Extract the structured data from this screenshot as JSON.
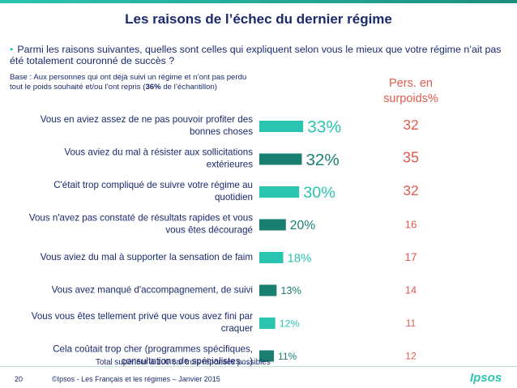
{
  "title": "Les raisons de l’échec du dernier régime",
  "question": "Parmi les raisons suivantes, quelles sont celles qui expliquent selon vous le mieux que votre régime n’ait pas été totalement couronné de succès ?",
  "base": {
    "text_before": "Base : Aux personnes qui ont déjà suivi un régime et n’ont pas perdu tout le poids souhaité et/ou l’ont repris (",
    "bold": "36%",
    "text_after": " de l’échantillon)"
  },
  "column_header": {
    "line1": "Pers. en",
    "line2": "surpoids%"
  },
  "footnote": "Total supérieur à 100 car trois réponses possibles",
  "footer": {
    "page_number": "20",
    "source": "©Ipsos - Les Français et les régimes –  Janvier 2015",
    "logo": "Ipsos"
  },
  "colors": {
    "light_bar": "#2bc4b0",
    "dark_bar": "#1a7f70",
    "label_text": "#1a2a6c",
    "overweight_text": "#e05a4e"
  },
  "chart_data": {
    "type": "bar",
    "orientation": "horizontal",
    "categories": [
      [
        "Vous en aviez assez de ne pas pouvoir profiter des",
        "bonnes choses"
      ],
      [
        "Vous aviez du mal à résister aux sollicitations",
        "extérieures"
      ],
      [
        "C'était trop compliqué de suivre votre régime au",
        "quotidien"
      ],
      [
        "Vous n'avez pas constaté de résultats rapides et vous",
        "vous êtes découragé"
      ],
      [
        "Vous aviez du mal à supporter la sensation de faim"
      ],
      [
        "Vous avez manqué d'accompagnement, de suivi"
      ],
      [
        "Vous vous êtes tellement privé que vous avez fini par",
        "craquer"
      ],
      [
        "Cela coûtait trop cher (programmes spécifiques,",
        "consultations de spécialistes…)"
      ]
    ],
    "values": [
      33,
      32,
      30,
      20,
      18,
      13,
      12,
      11
    ],
    "value_labels": [
      "33%",
      "32%",
      "30%",
      "20%",
      "18%",
      "13%",
      "12%",
      "11%"
    ],
    "overweight_values": [
      "32",
      "35",
      "32",
      "16",
      "17",
      "14",
      "11",
      "12"
    ],
    "xlim": [
      0,
      35
    ],
    "grid": false
  }
}
